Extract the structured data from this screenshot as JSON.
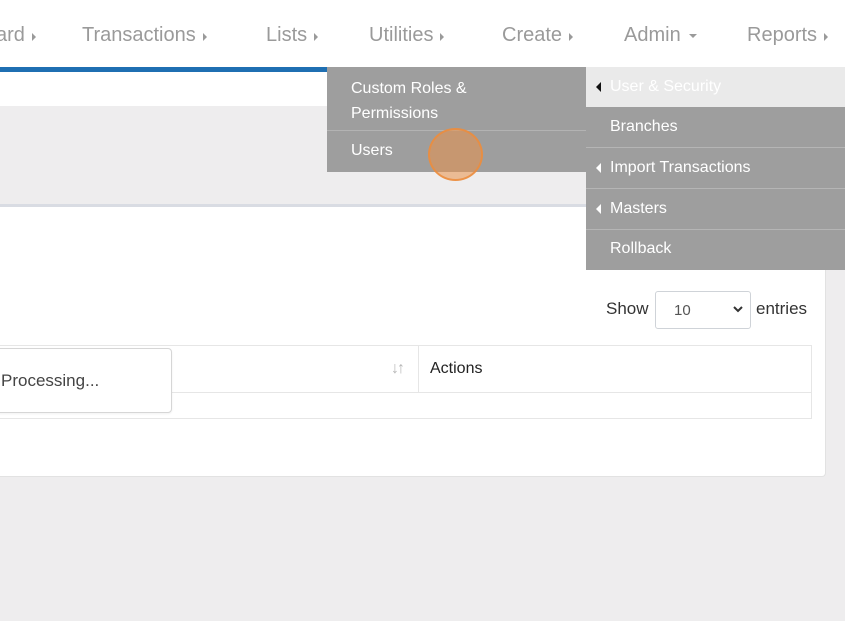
{
  "colors": {
    "top_blue": "#2f7bc2",
    "top_orange": "#e09145",
    "top_black": "#111111",
    "nav_text": "#9a9a9a",
    "nav_underline": "#1f6fb2",
    "menu_bg": "#9e9e9e",
    "page_bg": "#eeedee",
    "click_highlight": "#e9914b"
  },
  "navbar": {
    "items": [
      {
        "label": "ard",
        "caret": "right"
      },
      {
        "label": "Transactions",
        "caret": "right"
      },
      {
        "label": "Lists",
        "caret": "right"
      },
      {
        "label": "Utilities",
        "caret": "right"
      },
      {
        "label": "Create",
        "caret": "right"
      },
      {
        "label": "Admin",
        "caret": "down"
      },
      {
        "label": "Reports",
        "caret": "right"
      }
    ]
  },
  "admin_menu": {
    "items": [
      {
        "label_line1": "Custom Roles &",
        "label_line2": "Permissions"
      },
      {
        "label": "Users"
      }
    ]
  },
  "submenu": {
    "items": [
      {
        "label": "User & Security",
        "has_submenu": true,
        "active": true
      },
      {
        "label": "Branches",
        "has_submenu": false
      },
      {
        "label": "Import Transactions",
        "has_submenu": true
      },
      {
        "label": "Masters",
        "has_submenu": true
      },
      {
        "label": "Rollback",
        "has_submenu": false
      }
    ]
  },
  "table": {
    "show_label": "Show",
    "entries_value": "10",
    "entries_label": "entries",
    "sort_icon": "sort-icon",
    "actions_header": "Actions",
    "processing_text": "Processing..."
  }
}
